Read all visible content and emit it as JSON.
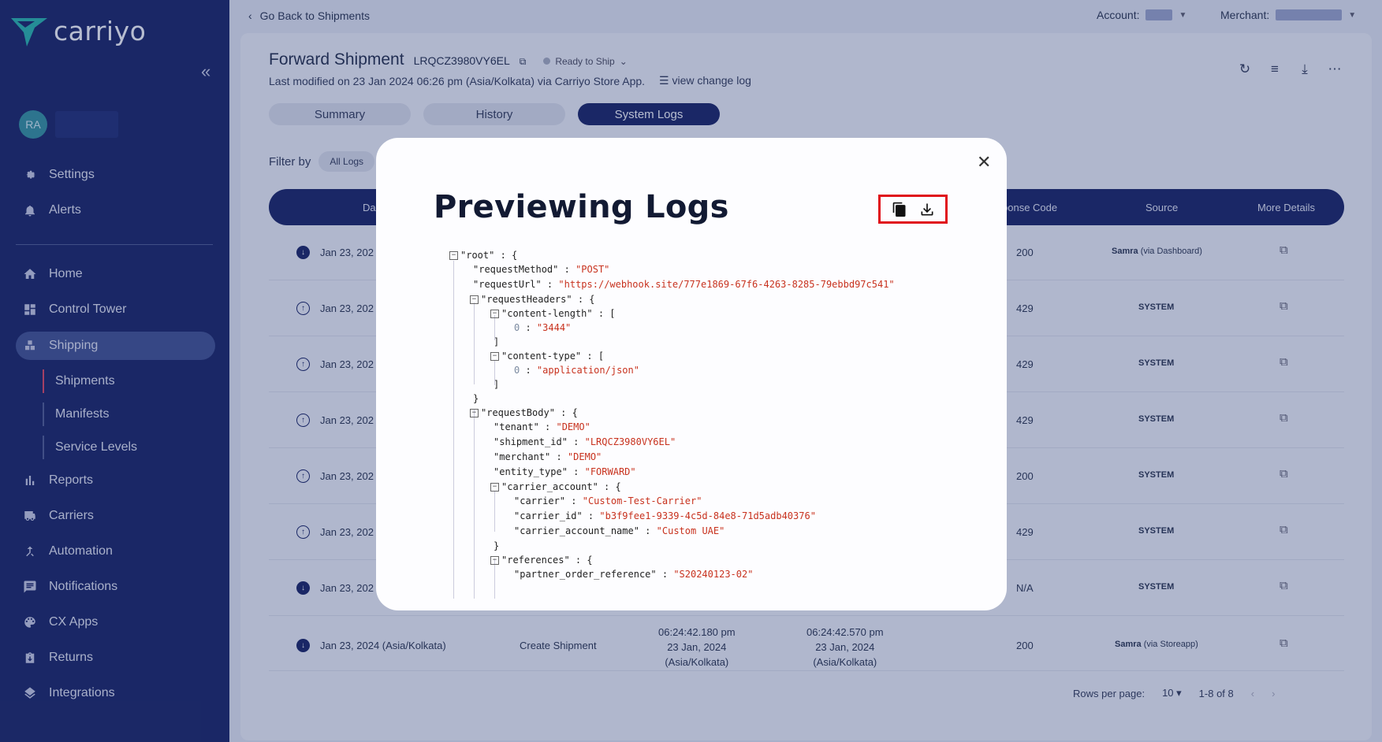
{
  "brand": {
    "name": "carriyo"
  },
  "user": {
    "initials": "RA"
  },
  "nav": {
    "settings": "Settings",
    "alerts": "Alerts",
    "home": "Home",
    "control_tower": "Control Tower",
    "shipping": "Shipping",
    "shipments": "Shipments",
    "manifests": "Manifests",
    "service_levels": "Service Levels",
    "reports": "Reports",
    "carriers": "Carriers",
    "automation": "Automation",
    "notifications": "Notifications",
    "cx_apps": "CX Apps",
    "returns": "Returns",
    "integrations": "Integrations"
  },
  "topbar": {
    "back": "Go Back to Shipments",
    "account_label": "Account:",
    "merchant_label": "Merchant:"
  },
  "shipment": {
    "title": "Forward Shipment",
    "id": "LRQCZ3980VY6EL",
    "status": "Ready to Ship",
    "modified": "Last modified on 23 Jan 2024 06:26 pm (Asia/Kolkata) via Carriyo Store App.",
    "change_log": "view change log"
  },
  "tabs": [
    "Summary",
    "History",
    "System Logs"
  ],
  "filter": {
    "label": "Filter by",
    "chip": "All Logs"
  },
  "table": {
    "headers": {
      "date": "Da",
      "response": "ponse Code",
      "source": "Source",
      "details": "More Details"
    },
    "rows": [
      {
        "date": "Jan 23, 202",
        "code": "200",
        "source": "Samra",
        "via": "(via Dashboard)",
        "dir": "down"
      },
      {
        "date": "Jan 23, 202",
        "code": "429",
        "source": "SYSTEM",
        "via": "",
        "dir": "up"
      },
      {
        "date": "Jan 23, 202",
        "code": "429",
        "source": "SYSTEM",
        "via": "",
        "dir": "up"
      },
      {
        "date": "Jan 23, 202",
        "code": "429",
        "source": "SYSTEM",
        "via": "",
        "dir": "up"
      },
      {
        "date": "Jan 23, 202",
        "code": "200",
        "source": "SYSTEM",
        "via": "",
        "dir": "up"
      },
      {
        "date": "Jan 23, 202",
        "code": "429",
        "source": "SYSTEM",
        "via": "",
        "dir": "up"
      },
      {
        "date": "Jan 23, 202",
        "code": "N/A",
        "source": "SYSTEM",
        "via": "",
        "dir": "down"
      }
    ],
    "last_row": {
      "date": "Jan 23, 2024 (Asia/Kolkata)",
      "event": "Create Shipment",
      "t1_time": "06:24:42.180 pm",
      "t1_date": "23 Jan, 2024",
      "t1_tz": "(Asia/Kolkata)",
      "t2_time": "06:24:42.570 pm",
      "t2_date": "23 Jan, 2024",
      "t2_tz": "(Asia/Kolkata)",
      "code": "200",
      "source": "Samra",
      "via": "(via Storeapp)"
    }
  },
  "pager": {
    "rows_label": "Rows per page:",
    "rows_value": "10",
    "range": "1-8 of 8"
  },
  "modal": {
    "title": "Previewing Logs",
    "json": {
      "root_key": "\"root\"",
      "request_method_key": "\"requestMethod\"",
      "request_method_val": "\"POST\"",
      "request_url_key": "\"requestUrl\"",
      "request_url_val": "\"https://webhook.site/777e1869-67f6-4263-8285-79ebbd97c541\"",
      "request_headers_key": "\"requestHeaders\"",
      "content_length_key": "\"content-length\"",
      "content_length_val": "\"3444\"",
      "content_type_key": "\"content-type\"",
      "content_type_val": "\"application/json\"",
      "request_body_key": "\"requestBody\"",
      "tenant_key": "\"tenant\"",
      "tenant_val": "\"DEMO\"",
      "shipment_id_key": "\"shipment_id\"",
      "shipment_id_val": "\"LRQCZ3980VY6EL\"",
      "merchant_key": "\"merchant\"",
      "merchant_val": "\"DEMO\"",
      "entity_type_key": "\"entity_type\"",
      "entity_type_val": "\"FORWARD\"",
      "carrier_account_key": "\"carrier_account\"",
      "carrier_key": "\"carrier\"",
      "carrier_val": "\"Custom-Test-Carrier\"",
      "carrier_id_key": "\"carrier_id\"",
      "carrier_id_val": "\"b3f9fee1-9339-4c5d-84e8-71d5adb40376\"",
      "carrier_account_name_key": "\"carrier_account_name\"",
      "carrier_account_name_val": "\"Custom UAE\"",
      "references_key": "\"references\"",
      "partner_order_reference_key": "\"partner_order_reference\"",
      "partner_order_reference_val": "\"S20240123-02\"",
      "index_zero": "0"
    }
  },
  "colors": {
    "sidebar": "#0e1a5c",
    "accent_active": "#e2405a",
    "json_string": "#c8321e",
    "highlight_box": "#e0101a"
  }
}
